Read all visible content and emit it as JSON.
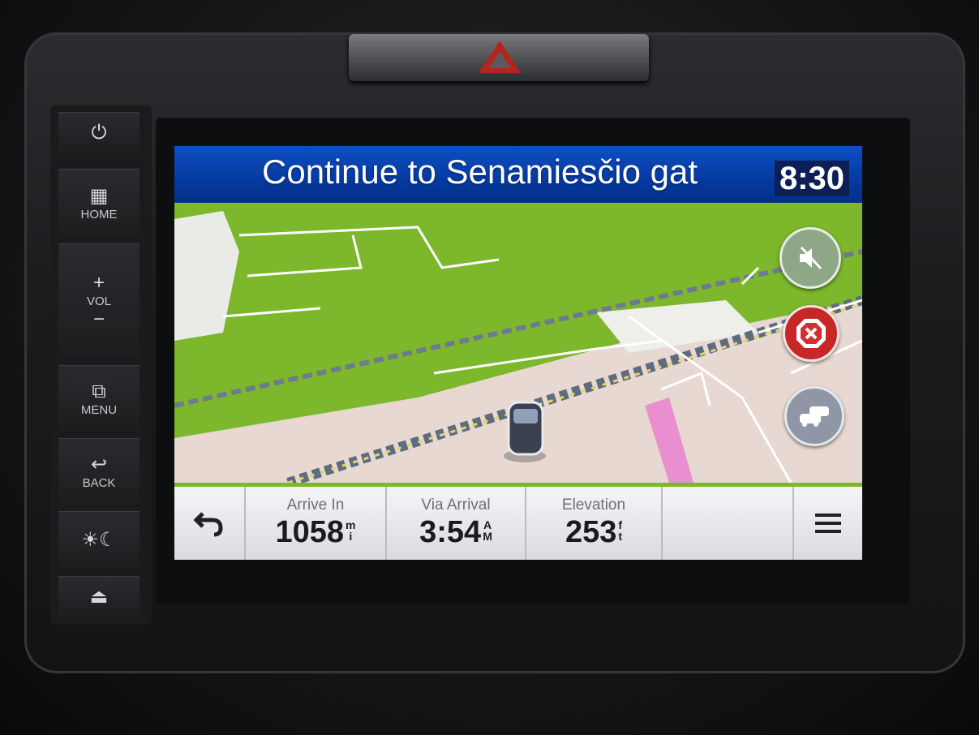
{
  "navigation": {
    "instruction": "Continue to Senamiesčio gat",
    "clock": "8:30"
  },
  "hardware_buttons": {
    "home": "HOME",
    "vol": "VOL",
    "menu": "MENU",
    "back": "BACK"
  },
  "trip_fields": [
    {
      "label": "Arrive In",
      "value": "1058",
      "unit_top": "m",
      "unit_bottom": "i"
    },
    {
      "label": "Via Arrival",
      "value": "3:54",
      "unit_top": "A",
      "unit_bottom": "M"
    },
    {
      "label": "Elevation",
      "value": "253",
      "unit_top": "f",
      "unit_bottom": "t"
    }
  ],
  "colors": {
    "topbar_blue": "#0a47b8",
    "map_green": "#7cb72c",
    "road_pink": "#e98fd0",
    "stop_red": "#d32f2f"
  },
  "icons": {
    "mute": "speaker-muted-icon",
    "stop": "stop-route-icon",
    "traffic": "traffic-icon",
    "back": "back-arrow-icon",
    "menu": "hamburger-menu-icon",
    "vehicle": "vehicle-marker-icon"
  }
}
